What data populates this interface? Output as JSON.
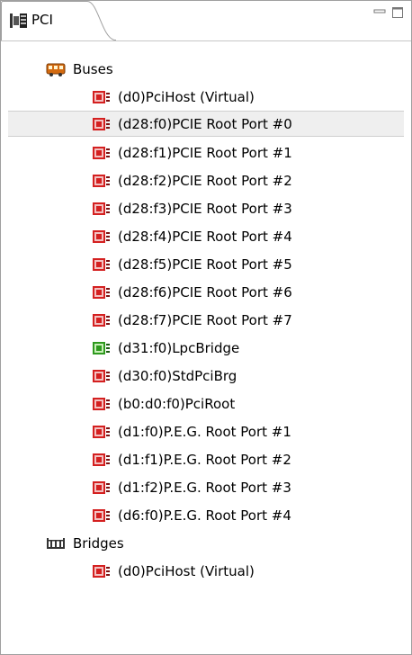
{
  "tab": {
    "title": "PCI",
    "icon": "pci-view-icon"
  },
  "controls": {
    "minimize": "minimize-icon",
    "maximize": "maximize-icon"
  },
  "tree": {
    "buses": {
      "label": "Buses",
      "icon": "bus-icon",
      "children": [
        {
          "label": "(d0)PciHost (Virtual)",
          "icon": "pci-device-icon"
        },
        {
          "label": "(d28:f0)PCIE Root Port #0",
          "icon": "pci-device-icon",
          "selected": true
        },
        {
          "label": "(d28:f1)PCIE Root Port #1",
          "icon": "pci-device-icon"
        },
        {
          "label": "(d28:f2)PCIE Root Port #2",
          "icon": "pci-device-icon"
        },
        {
          "label": "(d28:f3)PCIE Root Port #3",
          "icon": "pci-device-icon"
        },
        {
          "label": "(d28:f4)PCIE Root Port #4",
          "icon": "pci-device-icon"
        },
        {
          "label": "(d28:f5)PCIE Root Port #5",
          "icon": "pci-device-icon"
        },
        {
          "label": "(d28:f6)PCIE Root Port #6",
          "icon": "pci-device-icon"
        },
        {
          "label": "(d28:f7)PCIE Root Port #7",
          "icon": "pci-device-icon"
        },
        {
          "label": "(d31:f0)LpcBridge",
          "icon": "lpc-device-icon"
        },
        {
          "label": "(d30:f0)StdPciBrg",
          "icon": "pci-device-icon"
        },
        {
          "label": "(b0:d0:f0)PciRoot",
          "icon": "pci-device-icon"
        },
        {
          "label": "(d1:f0)P.E.G. Root Port #1",
          "icon": "pci-device-icon"
        },
        {
          "label": "(d1:f1)P.E.G. Root Port #2",
          "icon": "pci-device-icon"
        },
        {
          "label": "(d1:f2)P.E.G. Root Port #3",
          "icon": "pci-device-icon"
        },
        {
          "label": "(d6:f0)P.E.G. Root Port #4",
          "icon": "pci-device-icon"
        }
      ]
    },
    "bridges": {
      "label": "Bridges",
      "icon": "bridge-icon",
      "children": [
        {
          "label": "(d0)PciHost (Virtual)",
          "icon": "pci-device-icon"
        }
      ]
    }
  },
  "colors": {
    "device_red": "#d42020",
    "lpc_green": "#2e9a1e",
    "bus_orange": "#d36a10",
    "selection": "#efefef"
  }
}
